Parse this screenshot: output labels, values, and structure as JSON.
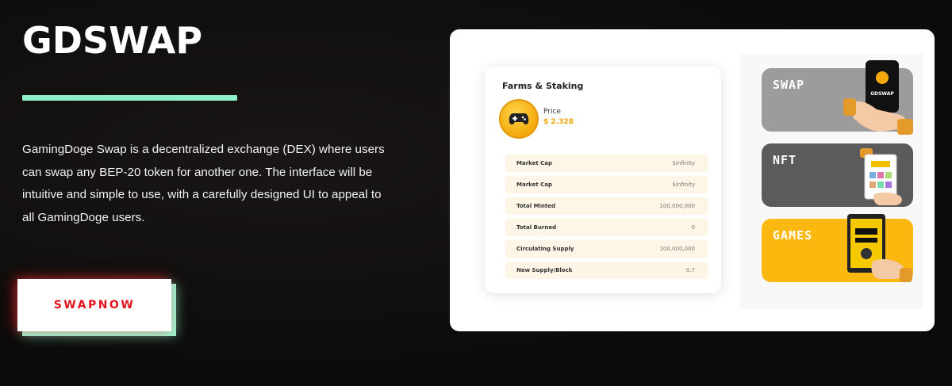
{
  "hero": {
    "title": "GDSWAP",
    "description": "GamingDoge Swap is a decentralized exchange (DEX) where users can swap any BEP-20 token for another one. The interface will be intuitive and simple to use, with a carefully designed UI to appeal to all GamingDoge users.",
    "cta_label": "SWAPNOW"
  },
  "colors": {
    "accent_green": "#8df0c8",
    "cta_red": "#e3141e",
    "gold": "#f1a608"
  },
  "card": {
    "title": "Farms & Staking",
    "coin_icon": "gamepad-icon",
    "price_label": "Price",
    "price_value": "$ 2.328",
    "rows": [
      {
        "label": "Market Cap",
        "value": "$Infinity"
      },
      {
        "label": "Market Cap",
        "value": "$Infinity"
      },
      {
        "label": "Total Minted",
        "value": "100,000,000"
      },
      {
        "label": "Total Burned",
        "value": "0"
      },
      {
        "label": "Circulating Supply",
        "value": "100,000,000"
      },
      {
        "label": "New Supply/Block",
        "value": "0.7"
      }
    ]
  },
  "tiles": {
    "swap": "SWAP",
    "nft": "NFT",
    "games": "GAMES",
    "phone_brand": "GDSWAP"
  }
}
